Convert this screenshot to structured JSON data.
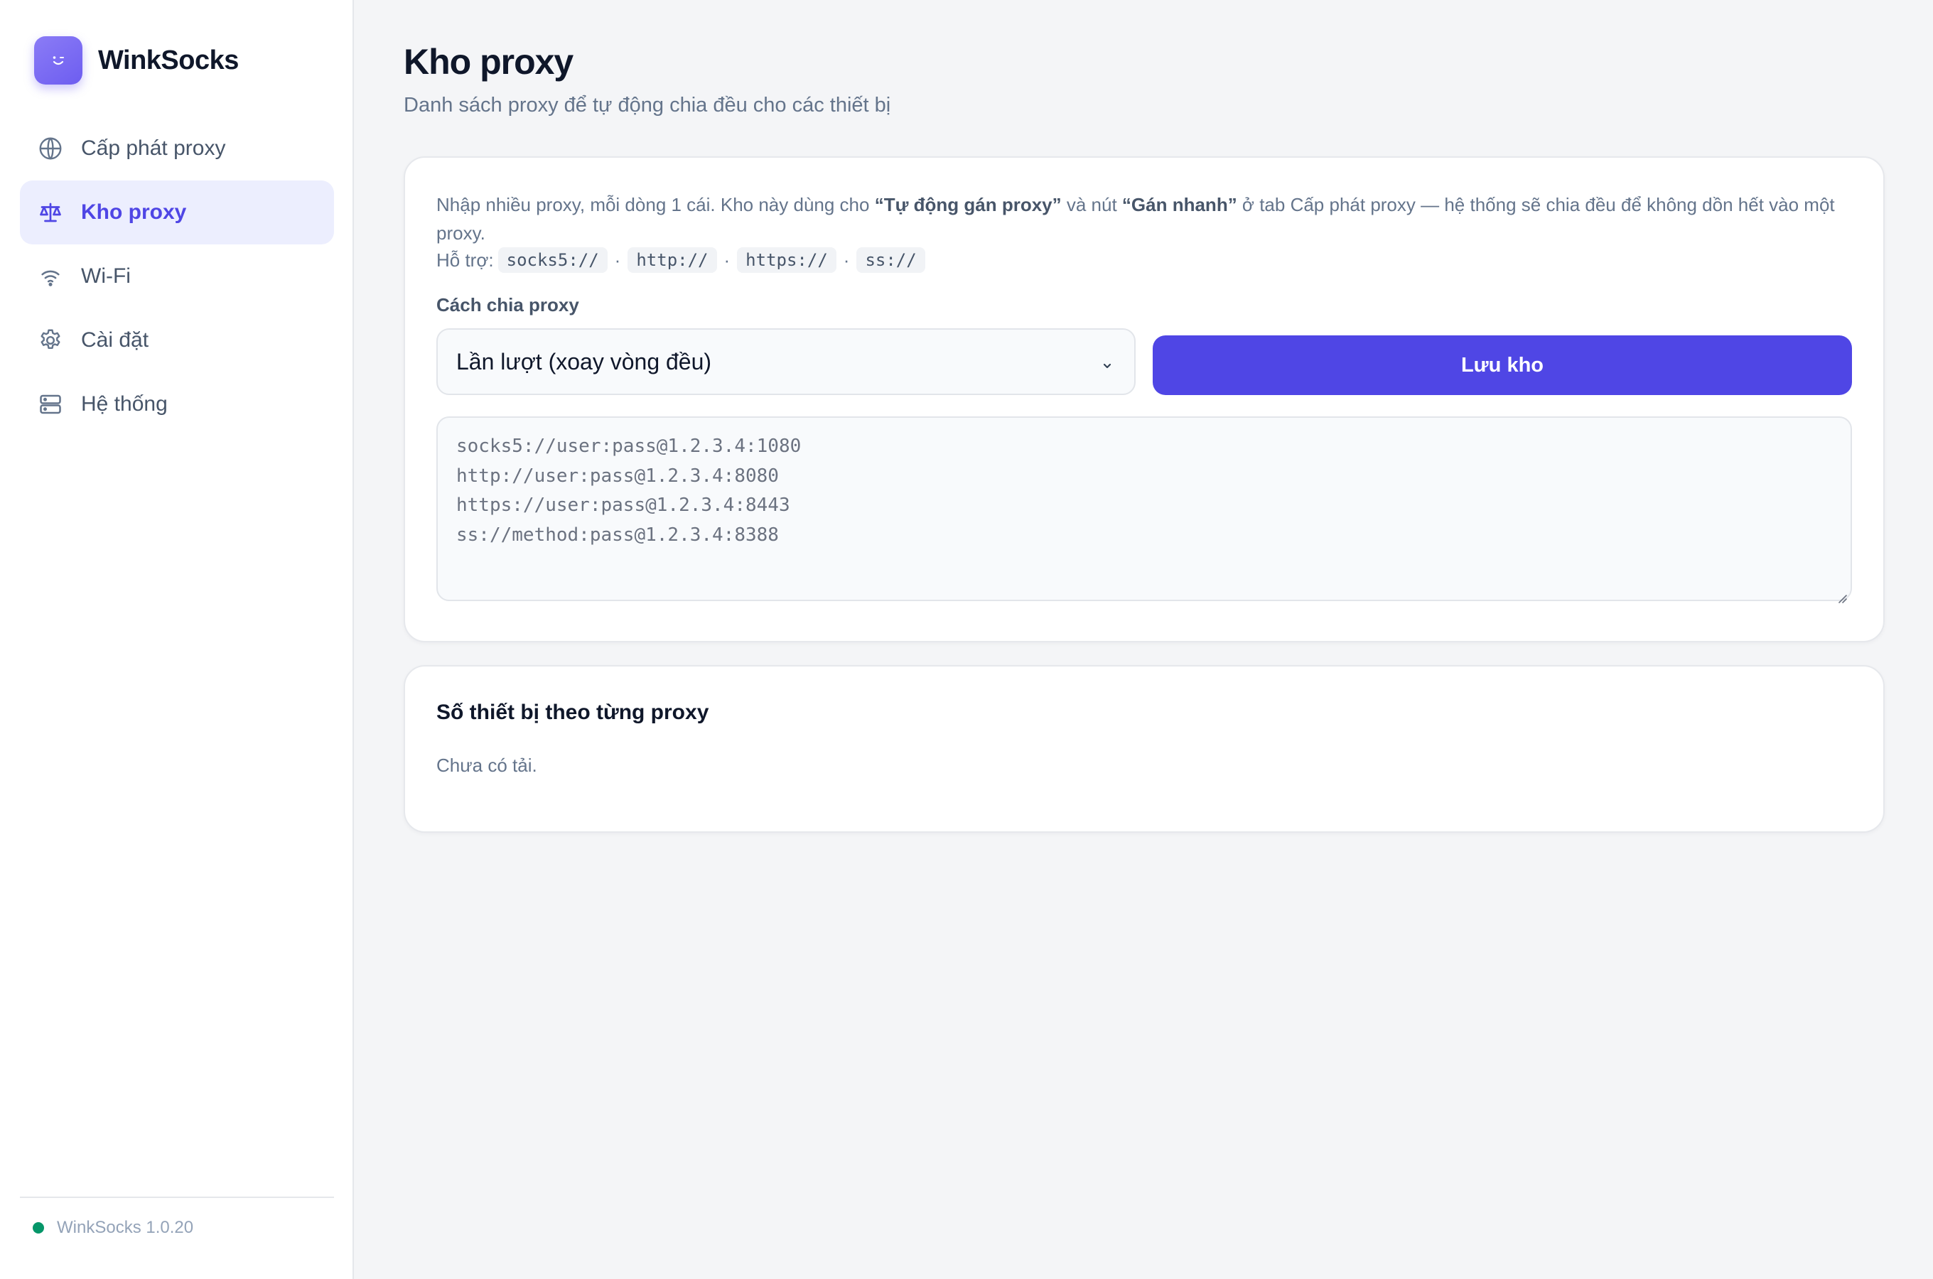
{
  "brand": {
    "name": "WinkSocks",
    "logo_icon": "wink-face-icon"
  },
  "sidebar": {
    "items": [
      {
        "label": "Cấp phát proxy",
        "icon": "globe-icon",
        "active": false
      },
      {
        "label": "Kho proxy",
        "icon": "scale-icon",
        "active": true
      },
      {
        "label": "Wi-Fi",
        "icon": "wifi-icon",
        "active": false
      },
      {
        "label": "Cài đặt",
        "icon": "gear-icon",
        "active": false
      },
      {
        "label": "Hệ thống",
        "icon": "server-icon",
        "active": false
      }
    ],
    "footer": {
      "version": "WinkSocks 1.0.20",
      "status_color": "#059669"
    }
  },
  "page": {
    "title": "Kho proxy",
    "subtitle": "Danh sách proxy để tự động chia đều cho các thiết bị"
  },
  "pool_card": {
    "intro_1": "Nhập nhiều proxy, mỗi dòng 1 cái. Kho này dùng cho ",
    "intro_bold_1": "“Tự động gán proxy”",
    "intro_2": " và nút ",
    "intro_bold_2": "“Gán nhanh”",
    "intro_3": " ở tab Cấp phát proxy — hệ thống sẽ chia đều để không dồn hết vào một proxy.",
    "support_label": "Hỗ trợ:",
    "protocols": [
      "socks5://",
      "http://",
      "https://",
      "ss://"
    ],
    "separator": "·",
    "strategy_label": "Cách chia proxy",
    "strategy_value": "Lần lượt (xoay vòng đều)",
    "save_label": "Lưu kho",
    "proxy_lines": [
      "socks5://user:pass@1.2.3.4:1080",
      "http://user:pass@1.2.3.4:8080",
      "https://user:pass@1.2.3.4:8443",
      "ss://method:pass@1.2.3.4:8388"
    ]
  },
  "load_card": {
    "title": "Số thiết bị theo từng proxy",
    "empty_text": "Chưa có tải."
  },
  "colors": {
    "accent": "#4f46e5",
    "active_bg": "#eceefe",
    "logo": "#7c6cf4"
  }
}
